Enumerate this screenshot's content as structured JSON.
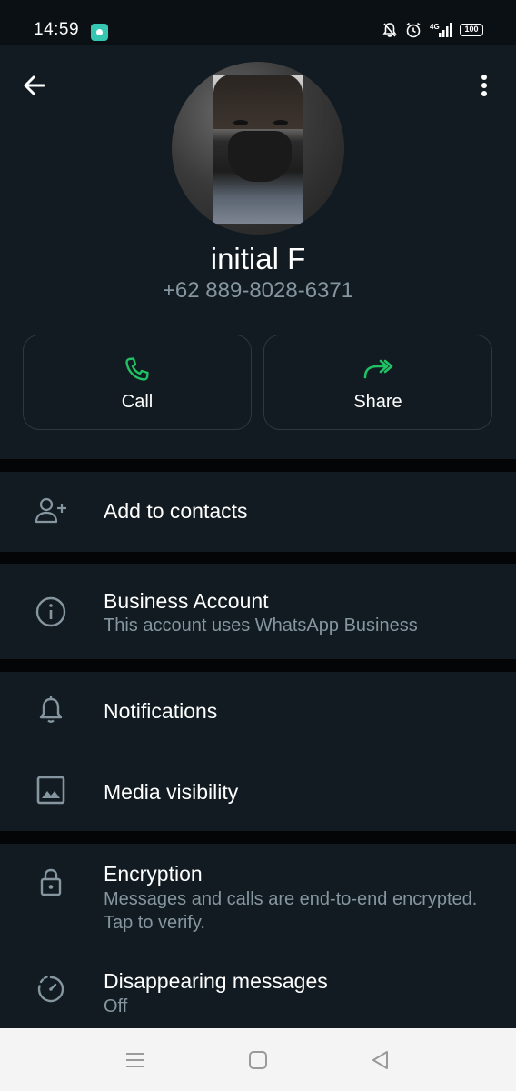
{
  "status_bar": {
    "time": "14:59",
    "network": "4G",
    "battery": "100",
    "icons": [
      "app-icon",
      "mute-bell-icon",
      "alarm-icon",
      "signal-icon",
      "battery-icon"
    ]
  },
  "profile": {
    "name": "initial F",
    "phone": "+62 889-8028-6371"
  },
  "actions": {
    "call_label": "Call",
    "share_label": "Share"
  },
  "menu": {
    "add_contacts": {
      "title": "Add to contacts"
    },
    "business": {
      "title": "Business Account",
      "subtitle": "This account uses WhatsApp Business"
    },
    "notifications": {
      "title": "Notifications"
    },
    "media": {
      "title": "Media visibility"
    },
    "encryption": {
      "title": "Encryption",
      "subtitle": "Messages and calls are end-to-end encrypted. Tap to verify."
    },
    "disappearing": {
      "title": "Disappearing messages",
      "subtitle": "Off"
    }
  },
  "colors": {
    "background": "#030507",
    "panel": "#111b21",
    "accent_green": "#21c063",
    "secondary_text": "#8696a0"
  }
}
